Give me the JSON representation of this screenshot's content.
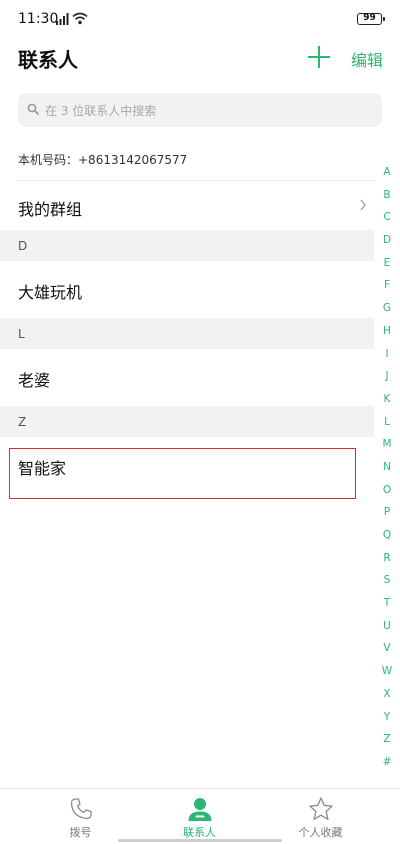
{
  "status_bar": {
    "time": "11:30",
    "battery": "99"
  },
  "header": {
    "title": "联系人",
    "add_icon": "plus-icon",
    "edit_label": "编辑"
  },
  "search": {
    "placeholder": "在 3 位联系人中搜索",
    "icon": "search-icon"
  },
  "my_number": "本机号码：+8613142067577",
  "group_row": {
    "label": "我的群组",
    "icon": "chevron-right-icon"
  },
  "sections": [
    {
      "letter": "D",
      "contacts": [
        "大雄玩机"
      ]
    },
    {
      "letter": "L",
      "contacts": [
        "老婆"
      ]
    },
    {
      "letter": "Z",
      "contacts": [
        "智能家"
      ]
    }
  ],
  "index_letters": [
    "A",
    "B",
    "C",
    "D",
    "E",
    "F",
    "G",
    "H",
    "I",
    "J",
    "K",
    "L",
    "M",
    "N",
    "O",
    "P",
    "Q",
    "R",
    "S",
    "T",
    "U",
    "V",
    "W",
    "X",
    "Y",
    "Z",
    "#"
  ],
  "bottom_nav": [
    {
      "label": "拨号",
      "icon": "phone-icon",
      "active": false
    },
    {
      "label": "联系人",
      "icon": "contact-person-icon",
      "active": true
    },
    {
      "label": "个人收藏",
      "icon": "star-icon",
      "active": false
    }
  ],
  "colors": {
    "accent": "#2bb673",
    "highlight_border": "#d32f2f",
    "section_bg": "#f2f2f2"
  }
}
